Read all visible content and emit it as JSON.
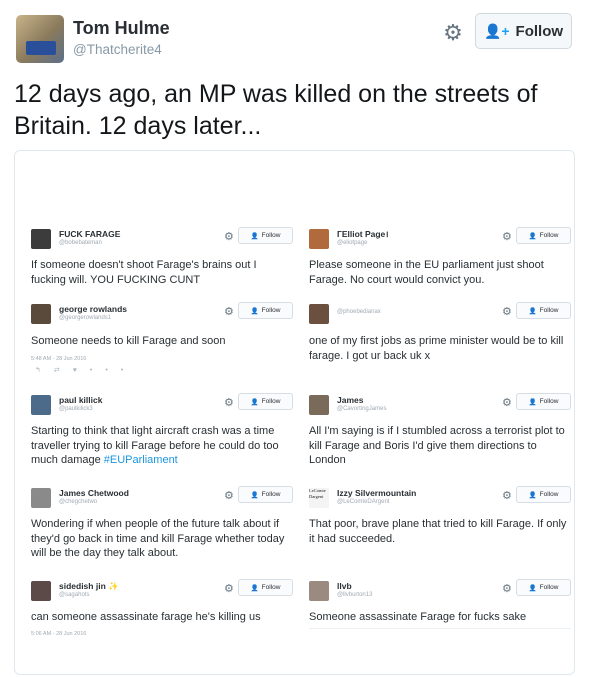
{
  "header": {
    "name": "Tom Hulme",
    "handle": "@Thatcherite4",
    "follow_label": "Follow"
  },
  "tweet_text": "12 days ago, an MP was killed on the streets of Britain. 12 days later...",
  "embedded": [
    {
      "name": "FUCK FARAGE",
      "handle": "@bobebateman",
      "follow": "Follow",
      "text": "If someone doesn't shoot Farage's brains out I fucking will. YOU FUCKING CUNT",
      "timestamp": "",
      "avatar_color": "#3c3c3c"
    },
    {
      "name": "ГElliot Page।",
      "handle": "@eliotpage",
      "follow": "Follow",
      "text": "Please someone in the EU parliament just shoot Farage. No court would convict you.",
      "timestamp": "",
      "avatar_color": "#b06a3b"
    },
    {
      "name": "george rowlands",
      "handle": "@georgerowlands1",
      "follow": "Follow",
      "text": "Someone needs to kill Farage and soon",
      "timestamp": "5:48 AM - 28 Jun 2016",
      "avatar_color": "#5a4a3c"
    },
    {
      "name": "",
      "handle": "@phoebedianax",
      "follow": "Follow",
      "text": "one of my first jobs as prime minister would be to kill farage. I got ur back uk x",
      "timestamp": "",
      "avatar_color": "#6b4f3f"
    },
    {
      "name": "paul killick",
      "handle": "@paulkilick3",
      "follow": "Follow",
      "text": "Starting to think that light aircraft crash was a time traveller trying to kill Farage before he could do too much damage ",
      "hashtag": "#EUParliament",
      "timestamp": "",
      "avatar_color": "#4c6b8a"
    },
    {
      "name": "James",
      "handle": "@CavortingJames",
      "follow": "Follow",
      "text": "All I'm saying is if I stumbled across a terrorist plot to kill Farage and Boris I'd give them directions to London",
      "timestamp": "",
      "avatar_color": "#7a6a5a"
    },
    {
      "name": "James Chetwood",
      "handle": "@chegchetwo",
      "follow": "Follow",
      "text": "Wondering if when people of the future talk about if they'd go back in time and kill Farage whether today will be the day they talk about.",
      "timestamp": "",
      "avatar_color": "#8a8a8a"
    },
    {
      "name": "Izzy Silvermountain",
      "handle": "@LeComteDArgent",
      "follow": "Follow",
      "text": "That poor, brave plane that tried to kill Farage. If only it had succeeded.",
      "timestamp": "",
      "avatar_color": "#3a3a3a",
      "avatar_text": "LeComte Dargent"
    },
    {
      "name": "sidedish jin ✨",
      "handle": "@sagahots",
      "follow": "Follow",
      "text": "can someone assassinate farage he's killing us",
      "timestamp": "5:06 AM - 28 Jun 2016",
      "avatar_color": "#5c4a48"
    },
    {
      "name": "llvb",
      "handle": "@llvburton13",
      "follow": "Follow",
      "text": "Someone assassinate Farage for fucks sake",
      "timestamp": "",
      "avatar_color": "#9a8a80"
    }
  ],
  "icons": {
    "gear": "gear-icon",
    "follow": "add-user-icon",
    "reply": "reply-icon",
    "retweet": "retweet-icon",
    "like": "heart-icon",
    "more": "more-icon"
  }
}
